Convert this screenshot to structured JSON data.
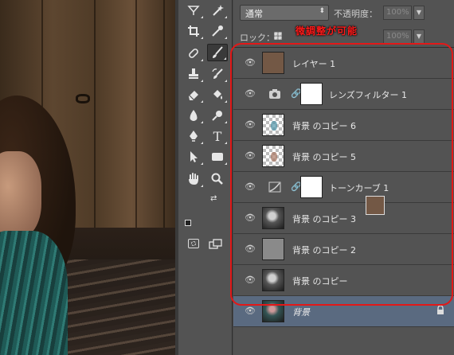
{
  "layers_panel": {
    "blend_mode": "通常",
    "opacity_label": "不透明度：",
    "opacity_value": "100%",
    "lock_label": "ロック：",
    "fill_value": "100%",
    "annotation": "微調整が可能",
    "layers": [
      {
        "name": "レイヤー 1",
        "thumb": "solid",
        "visible": true
      },
      {
        "name": "レンズフィルター 1",
        "thumb": "adjustment",
        "visible": true
      },
      {
        "name": "背景 のコピー 6",
        "thumb": "transparent",
        "visible": true
      },
      {
        "name": "背景 のコピー 5",
        "thumb": "transparent",
        "visible": true
      },
      {
        "name": "トーンカーブ 1",
        "thumb": "adjustment",
        "visible": true
      },
      {
        "name": "背景 のコピー 3",
        "thumb": "photo",
        "visible": true
      },
      {
        "name": "背景 のコピー 2",
        "thumb": "gray",
        "visible": true
      },
      {
        "name": "背景 のコピー",
        "thumb": "photo",
        "visible": true
      },
      {
        "name": "背景",
        "thumb": "photo",
        "visible": true,
        "locked": true,
        "selected": true
      }
    ]
  },
  "tools_panel": {
    "foreground_color": "#735845",
    "background_color": "#ffffff",
    "text_tool_glyph": "T"
  },
  "colors": {
    "annotation_red": "#e21818",
    "panel_bg": "#535353",
    "selected_row": "#5a6a80"
  }
}
